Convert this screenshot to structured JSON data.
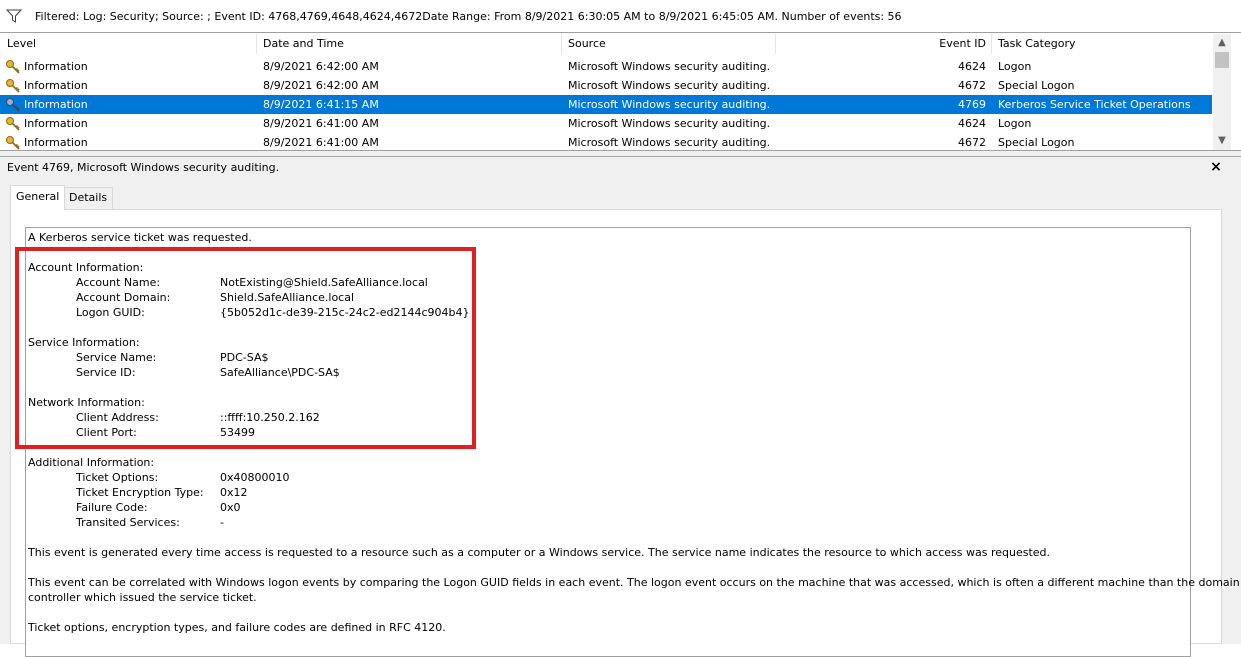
{
  "filter": {
    "icon": "funnel-icon",
    "text": "Filtered: Log: Security; Source: ; Event ID: 4768,4769,4648,4624,4672Date Range: From 8/9/2021 6:30:05 AM to 8/9/2021 6:45:05 AM. Number of events: 56"
  },
  "list": {
    "columns": [
      "Level",
      "Date and Time",
      "Source",
      "Event ID",
      "Task Category"
    ],
    "rows": [
      {
        "level": "Information",
        "datetime": "8/9/2021 6:42:00 AM",
        "source": "Microsoft Windows security auditing.",
        "event_id": "4624",
        "category": "Logon",
        "icon": "key-icon"
      },
      {
        "level": "Information",
        "datetime": "8/9/2021 6:42:00 AM",
        "source": "Microsoft Windows security auditing.",
        "event_id": "4672",
        "category": "Special Logon",
        "icon": "key-icon"
      },
      {
        "level": "Information",
        "datetime": "8/9/2021 6:41:15 AM",
        "source": "Microsoft Windows security auditing.",
        "event_id": "4769",
        "category": "Kerberos Service Ticket Operations",
        "icon": "key-icon",
        "selected": true
      },
      {
        "level": "Information",
        "datetime": "8/9/2021 6:41:00 AM",
        "source": "Microsoft Windows security auditing.",
        "event_id": "4624",
        "category": "Logon",
        "icon": "key-icon"
      },
      {
        "level": "Information",
        "datetime": "8/9/2021 6:41:00 AM",
        "source": "Microsoft Windows security auditing.",
        "event_id": "4672",
        "category": "Special Logon",
        "icon": "key-icon"
      }
    ]
  },
  "detail": {
    "title": "Event 4769, Microsoft Windows security auditing.",
    "close": "×",
    "tabs": [
      "General",
      "Details"
    ],
    "intro": "A Kerberos service ticket was requested.",
    "account_header": "Account Information:",
    "account": [
      {
        "label": "Account Name:",
        "value": "NotExisting@Shield.SafeAlliance.local"
      },
      {
        "label": "Account Domain:",
        "value": "Shield.SafeAlliance.local"
      },
      {
        "label": "Logon GUID:",
        "value": "{5b052d1c-de39-215c-24c2-ed2144c904b4}"
      }
    ],
    "service_header": "Service Information:",
    "service": [
      {
        "label": "Service Name:",
        "value": "PDC-SA$"
      },
      {
        "label": "Service ID:",
        "value": "SafeAlliance\\PDC-SA$"
      }
    ],
    "network_header": "Network Information:",
    "network": [
      {
        "label": "Client Address:",
        "value": "::ffff:10.250.2.162"
      },
      {
        "label": "Client Port:",
        "value": "53499"
      }
    ],
    "additional_header": "Additional Information:",
    "additional": [
      {
        "label": "Ticket Options:",
        "value": "0x40800010"
      },
      {
        "label": "Ticket Encryption Type:",
        "value": "0x12"
      },
      {
        "label": "Failure Code:",
        "value": "0x0"
      },
      {
        "label": "Transited Services:",
        "value": "-"
      }
    ],
    "para1": "This event is generated every time access is requested to a resource such as a computer or a Windows service.  The service name indicates the resource to which access was requested.",
    "para2_line1": "This event can be correlated with Windows logon events by comparing the Logon GUID fields in each event.  The logon event occurs on the machine that was accessed, which is often a different machine than the domain",
    "para2_line2": "controller which issued the service ticket.",
    "para3": "Ticket options, encryption types, and failure codes are defined in RFC 4120."
  },
  "colors": {
    "selection": "#0078d7",
    "highlight_box": "#e0201f"
  }
}
